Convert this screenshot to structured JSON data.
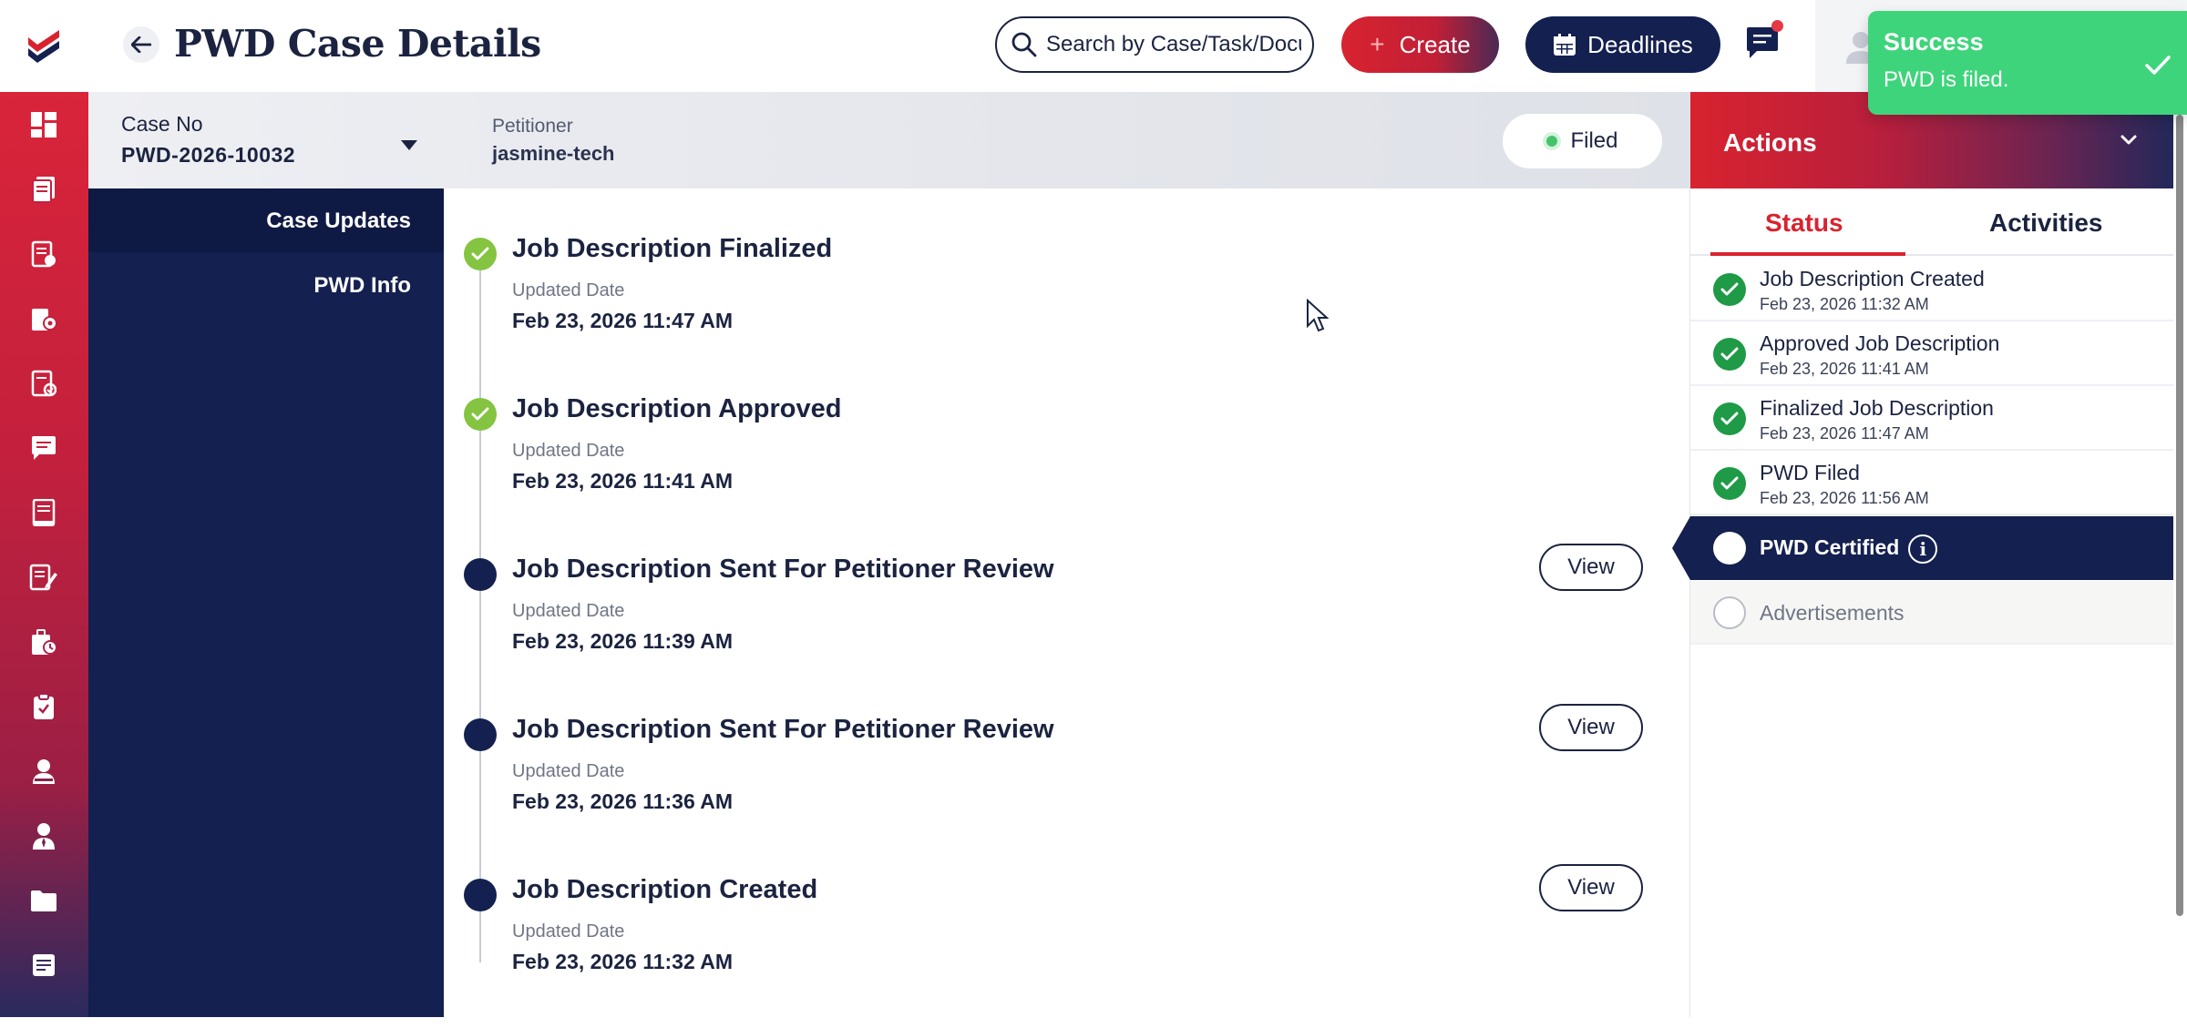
{
  "header": {
    "title": "PWD Case Details",
    "search_placeholder": "Search by Case/Task/Document",
    "create_label": "Create",
    "deadlines_label": "Deadlines"
  },
  "case": {
    "case_no_label": "Case No",
    "case_no": "PWD-2026-10032",
    "petitioner_label": "Petitioner",
    "petitioner": "jasmine-tech",
    "status": "Filed"
  },
  "left_nav": {
    "items": [
      {
        "label": "Case Updates"
      },
      {
        "label": "PWD Info"
      }
    ]
  },
  "timeline": {
    "items": [
      {
        "title": "Job Description Finalized",
        "sub": "Updated Date",
        "date": "Feb 23, 2026 11:47 AM",
        "state": "done",
        "view": ""
      },
      {
        "title": "Job Description Approved",
        "sub": "Updated Date",
        "date": "Feb 23, 2026 11:41 AM",
        "state": "done",
        "view": ""
      },
      {
        "title": "Job Description Sent For Petitioner Review",
        "sub": "Updated Date",
        "date": "Feb 23, 2026 11:39 AM",
        "state": "pending",
        "view": "View"
      },
      {
        "title": "Job Description Sent For Petitioner Review",
        "sub": "Updated Date",
        "date": "Feb 23, 2026 11:36 AM",
        "state": "pending",
        "view": "View"
      },
      {
        "title": "Job Description Created",
        "sub": "Updated Date",
        "date": "Feb 23, 2026 11:32 AM",
        "state": "pending",
        "view": "View"
      }
    ]
  },
  "actions": {
    "title": "Actions",
    "tabs": [
      {
        "label": "Status"
      },
      {
        "label": "Activities"
      }
    ],
    "status_items": [
      {
        "title": "Job Description Created",
        "date": "Feb 23, 2026 11:32 AM",
        "state": "done"
      },
      {
        "title": "Approved Job Description",
        "date": "Feb 23, 2026 11:41 AM",
        "state": "done"
      },
      {
        "title": "Finalized Job Description",
        "date": "Feb 23, 2026 11:47 AM",
        "state": "done"
      },
      {
        "title": "PWD Filed",
        "date": "Feb 23, 2026 11:56 AM",
        "state": "done"
      },
      {
        "title": "PWD Certified",
        "date": "",
        "state": "current"
      },
      {
        "title": "Advertisements",
        "date": "",
        "state": "empty"
      }
    ]
  },
  "toast": {
    "title": "Success",
    "message": "PWD is filed."
  },
  "colors": {
    "navy": "#132050",
    "brand_red": "#d8232f",
    "success_green": "#3ed47b",
    "done_green": "#1f9a46",
    "timeline_green": "#84c441"
  },
  "icons": {
    "rail": [
      "dashboard-icon",
      "documents-icon",
      "case-form-icon",
      "case-settings-icon",
      "checked-doc-icon",
      "chat-icon",
      "book-icon",
      "edit-list-icon",
      "briefcase-clock-icon",
      "clipboard-icon",
      "user-icon",
      "employee-icon",
      "folder-icon",
      "notes-icon"
    ]
  }
}
